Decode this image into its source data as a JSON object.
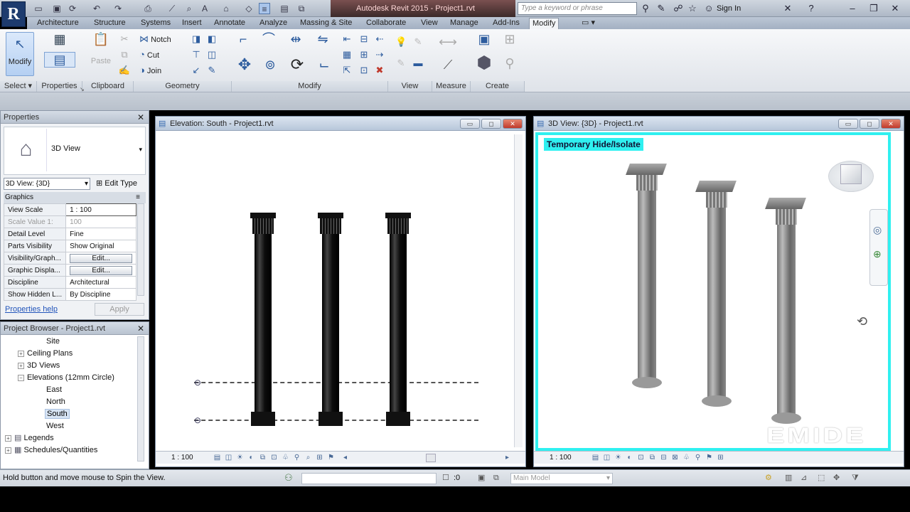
{
  "app": {
    "title": "Autodesk Revit 2015 -    Project1.rvt",
    "logo": "R",
    "search_placeholder": "Type a keyword or phrase",
    "sign_in": "Sign In"
  },
  "ribbon_tabs": [
    "Architecture",
    "Structure",
    "Systems",
    "Insert",
    "Annotate",
    "Analyze",
    "Massing & Site",
    "Collaborate",
    "View",
    "Manage",
    "Add-Ins",
    "Modify"
  ],
  "active_tab": "Modify",
  "ribbon": {
    "modify_label": "Modify",
    "properties_label": "Properties",
    "paste_label": "Paste",
    "notch_label": "Notch",
    "cut_label": "Cut",
    "join_label": "Join",
    "panels": [
      "Select",
      "Properties",
      "Clipboard",
      "Geometry",
      "Modify",
      "View",
      "Measure",
      "Create"
    ]
  },
  "properties_panel": {
    "header": "Properties",
    "type_name": "3D View",
    "view_selector": "3D View: {3D}",
    "edit_type": "Edit Type",
    "section": "Graphics",
    "rows": [
      {
        "label": "View Scale",
        "value": "1 : 100"
      },
      {
        "label": "Scale Value    1:",
        "value": "100"
      },
      {
        "label": "Detail Level",
        "value": "Fine"
      },
      {
        "label": "Parts Visibility",
        "value": "Show Original"
      },
      {
        "label": "Visibility/Graph...",
        "value": "Edit..."
      },
      {
        "label": "Graphic Displa...",
        "value": "Edit..."
      },
      {
        "label": "Discipline",
        "value": "Architectural"
      },
      {
        "label": "Show Hidden L...",
        "value": "By Discipline"
      }
    ],
    "help_link": "Properties help",
    "apply": "Apply"
  },
  "project_browser": {
    "header": "Project Browser - Project1.rvt",
    "items": [
      {
        "label": "Site",
        "level": 3,
        "selected": false
      },
      {
        "label": "Ceiling Plans",
        "level": 2,
        "selected": false
      },
      {
        "label": "3D Views",
        "level": 2,
        "selected": false
      },
      {
        "label": "Elevations (12mm Circle)",
        "level": 2,
        "selected": false
      },
      {
        "label": "East",
        "level": 3,
        "selected": false
      },
      {
        "label": "North",
        "level": 3,
        "selected": false
      },
      {
        "label": "South",
        "level": 3,
        "selected": true
      },
      {
        "label": "West",
        "level": 3,
        "selected": false
      },
      {
        "label": "Legends",
        "level": 1,
        "selected": false
      },
      {
        "label": "Schedules/Quantities",
        "level": 1,
        "selected": false
      }
    ]
  },
  "views": {
    "elevation": {
      "title": "Elevation: South - Project1.rvt",
      "scale": "1 : 100"
    },
    "view3d": {
      "title": "3D View: {3D} - Project1.rvt",
      "scale": "1 : 100",
      "banner": "Temporary Hide/Isolate"
    }
  },
  "status": {
    "text": "Hold button and move mouse to Spin the View.",
    "filter_count": ":0",
    "model": "Main Model"
  },
  "watermark": "EMIDE",
  "colors": {
    "accent": "#2ff0f0",
    "brand": "#1d3b6e"
  }
}
